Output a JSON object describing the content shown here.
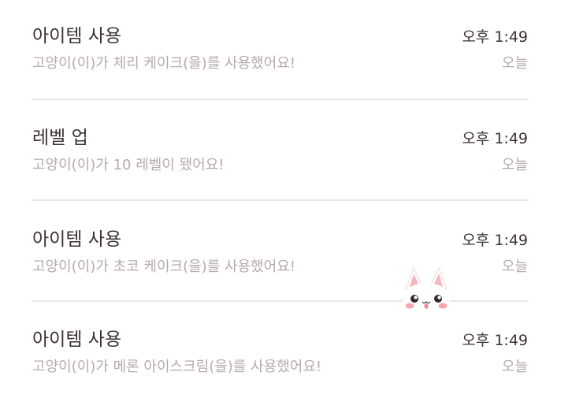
{
  "notifications": [
    {
      "title": "아이템 사용",
      "time": "오후 1:49",
      "description": "고양이(이)가 체리 케이크(을)를 사용했어요!",
      "date": "오늘"
    },
    {
      "title": "레벨 업",
      "time": "오후 1:49",
      "description": "고양이(이)가 10 레벨이 됐어요!",
      "date": "오늘"
    },
    {
      "title": "아이템 사용",
      "time": "오후 1:49",
      "description": "고양이(이)가 초코 케이크(을)를 사용했어요!",
      "date": "오늘"
    },
    {
      "title": "아이템 사용",
      "time": "오후 1:49",
      "description": "고양이(이)가 메론 아이스크림(을)를 사용했어요!",
      "date": "오늘"
    }
  ],
  "colors": {
    "title_text": "#3b3230",
    "secondary_text": "#b6aaa8",
    "divider": "#ece4e3",
    "background": "#ffffff"
  },
  "icons": {
    "floating_mascot": "cat-face-icon"
  }
}
